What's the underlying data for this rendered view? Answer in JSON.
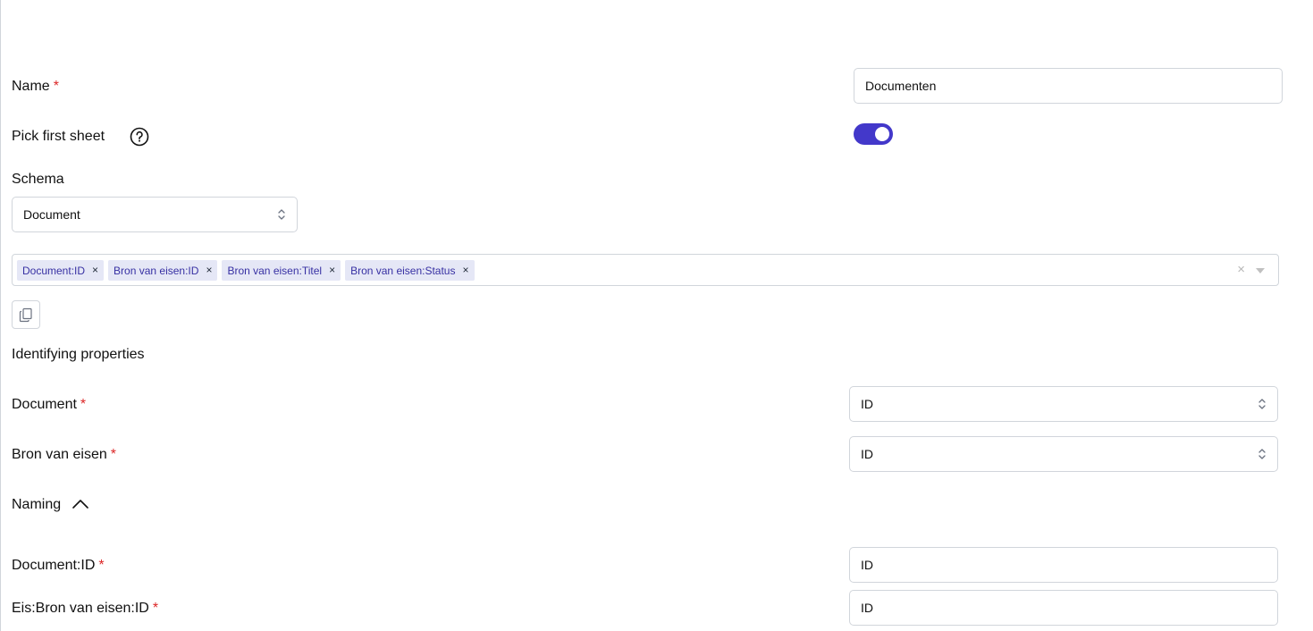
{
  "form": {
    "name": {
      "label": "Name",
      "required_mark": "*",
      "value": "Documenten"
    },
    "pick_first_sheet": {
      "label": "Pick first sheet",
      "enabled": true
    },
    "schema": {
      "heading": "Schema",
      "selected": "Document"
    },
    "columns": {
      "chips": [
        "Document:ID",
        "Bron van eisen:ID",
        "Bron van eisen:Titel",
        "Bron van eisen:Status"
      ],
      "remove_glyph": "×",
      "clear_glyph": "×"
    },
    "identifying_properties": {
      "heading": "Identifying properties",
      "rows": [
        {
          "label": "Document",
          "required_mark": "*",
          "value": "ID"
        },
        {
          "label": "Bron van eisen",
          "required_mark": "*",
          "value": "ID"
        }
      ]
    },
    "naming": {
      "heading": "Naming",
      "expanded": true,
      "rows": [
        {
          "label": "Document:ID",
          "required_mark": "*",
          "value": "ID"
        },
        {
          "label": "Eis:Bron van eisen:ID",
          "required_mark": "*",
          "value": "ID"
        }
      ]
    }
  },
  "colors": {
    "accent": "#4338ca",
    "required": "#dc2626",
    "chip_bg": "#e5e7f6",
    "border": "#d1d5db"
  },
  "icons": {
    "help": "question-circle-icon",
    "copy": "copy-icon",
    "select": "chevron-up-down-icon",
    "collapse": "chevron-up-icon"
  }
}
